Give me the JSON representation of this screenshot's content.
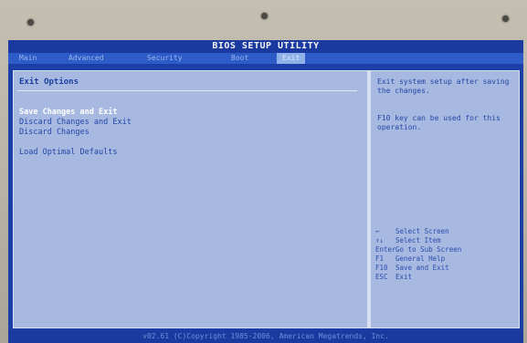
{
  "header": {
    "title": "BIOS SETUP UTILITY"
  },
  "tabs": [
    {
      "label": "Main"
    },
    {
      "label": "Advanced"
    },
    {
      "label": "Security"
    },
    {
      "label": "Boot"
    },
    {
      "label": "Exit",
      "active": true
    }
  ],
  "main": {
    "section_title": "Exit Options",
    "items": [
      {
        "label": "Save Changes and Exit",
        "selected": true
      },
      {
        "label": "Discard Changes and Exit"
      },
      {
        "label": "Discard Changes"
      },
      {
        "label": "Load Optimal Defaults"
      }
    ]
  },
  "help": {
    "description": "Exit system setup after saving the changes.",
    "hint": "F10 key can be used for this operation.",
    "keys": [
      {
        "key": "←",
        "action": "Select Screen"
      },
      {
        "key": "↑↓",
        "action": "Select Item"
      },
      {
        "key": "Enter",
        "action": "Go to Sub Screen"
      },
      {
        "key": "F1",
        "action": "General Help"
      },
      {
        "key": "F10",
        "action": "Save and Exit"
      },
      {
        "key": "ESC",
        "action": "Exit"
      }
    ]
  },
  "footer": {
    "text": "v02.61 (C)Copyright 1985-2006, American Megatrends, Inc."
  },
  "colors": {
    "screen_blue": "#1b3fa6",
    "panel": "#a7b9e1",
    "selected_text": "#ffffff"
  }
}
